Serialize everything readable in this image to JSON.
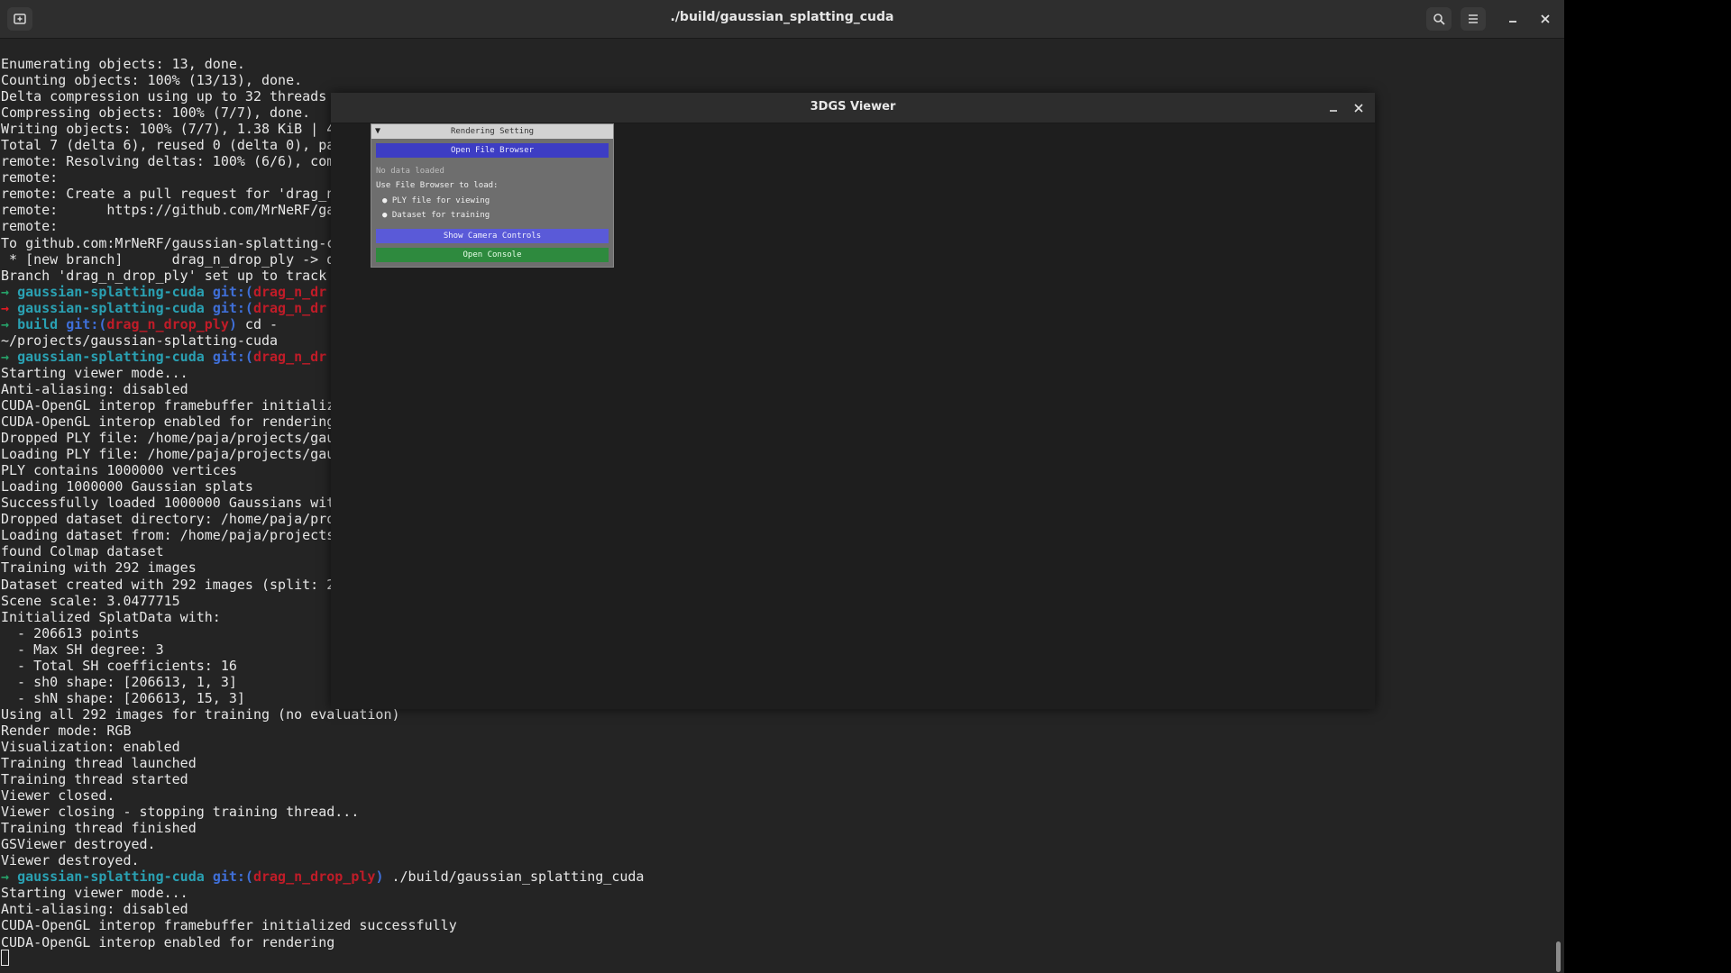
{
  "terminal": {
    "title": "./build/gaussian_splatting_cuda",
    "icons": {
      "new_tab": "new-tab-icon",
      "search": "search-icon",
      "menu": "hamburger-icon",
      "minimize": "minimize-icon",
      "close": "close-icon"
    },
    "lines": [
      [
        {
          "t": "Enumerating objects: 13, done."
        }
      ],
      [
        {
          "t": "Counting objects: 100% (13/13), done."
        }
      ],
      [
        {
          "t": "Delta compression using up to 32 threads"
        }
      ],
      [
        {
          "t": "Compressing objects: 100% (7/7), done."
        }
      ],
      [
        {
          "t": "Writing objects: 100% (7/7), 1.38 KiB | 4"
        }
      ],
      [
        {
          "t": "Total 7 (delta 6), reused 0 (delta 0), pa"
        }
      ],
      [
        {
          "t": "remote: Resolving deltas: 100% (6/6), com"
        }
      ],
      [
        {
          "t": "remote:"
        }
      ],
      [
        {
          "t": "remote: Create a pull request for 'drag_n"
        }
      ],
      [
        {
          "t": "remote:      https://github.com/MrNeRF/ga"
        }
      ],
      [
        {
          "t": "remote:"
        }
      ],
      [
        {
          "t": "To github.com:MrNeRF/gaussian-splatting-c"
        }
      ],
      [
        {
          "t": " * [new branch]      drag_n_drop_ply -> d"
        }
      ],
      [
        {
          "t": "Branch 'drag_n_drop_ply' set up to track "
        }
      ],
      [
        {
          "t": "→ ",
          "c": "arrow-ok"
        },
        {
          "t": "gaussian-splatting-cuda ",
          "c": "dir"
        },
        {
          "t": "git:(",
          "c": "git"
        },
        {
          "t": "drag_n_dr",
          "c": "branch"
        }
      ],
      [
        {
          "t": "→ ",
          "c": "arrow-err"
        },
        {
          "t": "gaussian-splatting-cuda ",
          "c": "dir"
        },
        {
          "t": "git:(",
          "c": "git"
        },
        {
          "t": "drag_n_dr",
          "c": "branch"
        }
      ],
      [
        {
          "t": "→ ",
          "c": "arrow-ok"
        },
        {
          "t": "build ",
          "c": "dir"
        },
        {
          "t": "git:(",
          "c": "git"
        },
        {
          "t": "drag_n_drop_ply",
          "c": "branch"
        },
        {
          "t": ")",
          "c": "git"
        },
        {
          "t": " cd -"
        }
      ],
      [
        {
          "t": "~/projects/gaussian-splatting-cuda"
        }
      ],
      [
        {
          "t": "→ ",
          "c": "arrow-ok"
        },
        {
          "t": "gaussian-splatting-cuda ",
          "c": "dir"
        },
        {
          "t": "git:(",
          "c": "git"
        },
        {
          "t": "drag_n_dr",
          "c": "branch"
        }
      ],
      [
        {
          "t": "Starting viewer mode..."
        }
      ],
      [
        {
          "t": "Anti-aliasing: disabled"
        }
      ],
      [
        {
          "t": "CUDA-OpenGL interop framebuffer initializ"
        }
      ],
      [
        {
          "t": "CUDA-OpenGL interop enabled for rendering"
        }
      ],
      [
        {
          "t": "Dropped PLY file: /home/paja/projects/gau"
        }
      ],
      [
        {
          "t": "Loading PLY file: /home/paja/projects/gau"
        }
      ],
      [
        {
          "t": "PLY contains 1000000 vertices"
        }
      ],
      [
        {
          "t": "Loading 1000000 Gaussian splats"
        }
      ],
      [
        {
          "t": "Successfully loaded 1000000 Gaussians wit"
        }
      ],
      [
        {
          "t": "Dropped dataset directory: /home/paja/pro"
        }
      ],
      [
        {
          "t": "Loading dataset from: /home/paja/projects"
        }
      ],
      [
        {
          "t": "found Colmap dataset"
        }
      ],
      [
        {
          "t": "Training with 292 images"
        }
      ],
      [
        {
          "t": "Dataset created with 292 images (split: 2"
        }
      ],
      [
        {
          "t": "Scene scale: 3.0477715"
        }
      ],
      [
        {
          "t": "Initialized SplatData with:"
        }
      ],
      [
        {
          "t": "  - 206613 points"
        }
      ],
      [
        {
          "t": "  - Max SH degree: 3"
        }
      ],
      [
        {
          "t": "  - Total SH coefficients: 16"
        }
      ],
      [
        {
          "t": "  - sh0 shape: [206613, 1, 3]"
        }
      ],
      [
        {
          "t": "  - shN shape: [206613, 15, 3]"
        }
      ],
      [
        {
          "t": "Using all 292 images for training (no evaluation)"
        }
      ],
      [
        {
          "t": "Render mode: RGB"
        }
      ],
      [
        {
          "t": "Visualization: enabled"
        }
      ],
      [
        {
          "t": "Training thread launched"
        }
      ],
      [
        {
          "t": "Training thread started"
        }
      ],
      [
        {
          "t": "Viewer closed."
        }
      ],
      [
        {
          "t": "Viewer closing - stopping training thread..."
        }
      ],
      [
        {
          "t": "Training thread finished"
        }
      ],
      [
        {
          "t": "GSViewer destroyed."
        }
      ],
      [
        {
          "t": "Viewer destroyed."
        }
      ],
      [
        {
          "t": "→ ",
          "c": "arrow-ok"
        },
        {
          "t": "gaussian-splatting-cuda ",
          "c": "dir"
        },
        {
          "t": "git:(",
          "c": "git"
        },
        {
          "t": "drag_n_drop_ply",
          "c": "branch"
        },
        {
          "t": ")",
          "c": "git"
        },
        {
          "t": " ./build/gaussian_splatting_cuda"
        }
      ],
      [
        {
          "t": "Starting viewer mode..."
        }
      ],
      [
        {
          "t": "Anti-aliasing: disabled"
        }
      ],
      [
        {
          "t": "CUDA-OpenGL interop framebuffer initialized successfully"
        }
      ],
      [
        {
          "t": "CUDA-OpenGL interop enabled for rendering"
        }
      ]
    ]
  },
  "viewer": {
    "title": "3DGS Viewer",
    "minimize_icon": "minimize-icon",
    "close_icon": "close-icon",
    "panel": {
      "title": "Rendering Setting",
      "collapse_icon": "triangle-down-icon",
      "open_file_browser": "Open File Browser",
      "status": "No data loaded",
      "hint": "Use File Browser to load:",
      "bullets": [
        "PLY file for viewing",
        "Dataset for training"
      ],
      "show_camera_controls": "Show Camera Controls",
      "open_console": "Open Console"
    }
  },
  "colors": {
    "terminal_bg": "#242424",
    "prompt_arrow_ok": "#26a269",
    "prompt_arrow_err": "#e01b24",
    "prompt_dir": "#2aa1b3",
    "prompt_git": "#3f6fd8",
    "prompt_branch": "#c01c28",
    "btn_file": "#3d3dc4",
    "btn_camera": "#5a5ad8",
    "btn_console": "#2e8a3e"
  }
}
